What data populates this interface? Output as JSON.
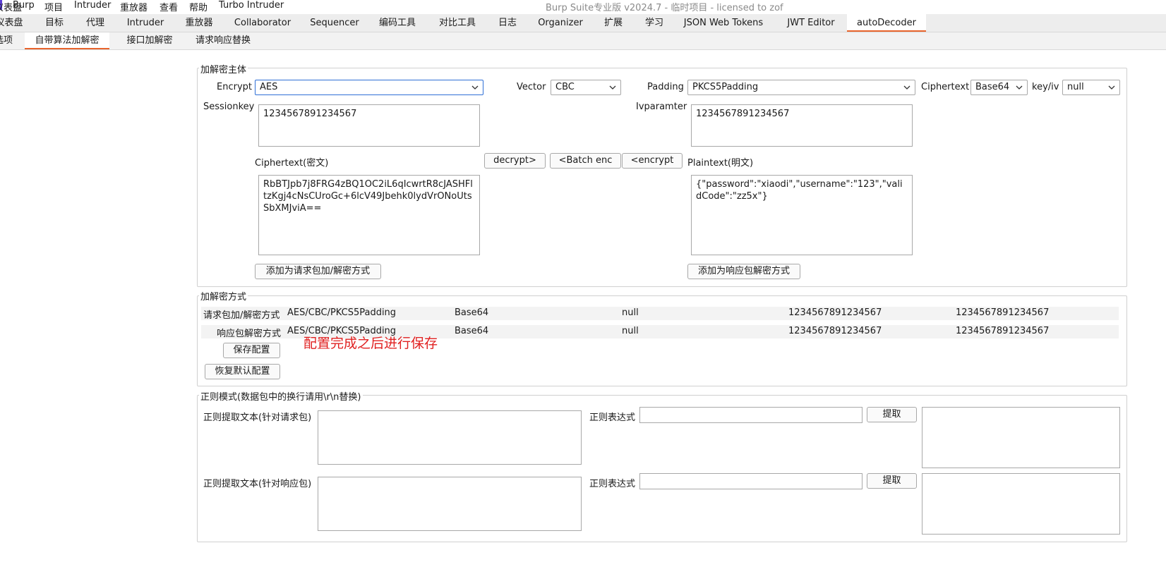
{
  "menubar": {
    "items": [
      "仪表盘",
      "Burp",
      "项目",
      "Intruder",
      "重放器",
      "查看",
      "帮助",
      "Turbo Intruder"
    ],
    "window_title": "Burp Suite专业版  v2024.7 - 临时项目 - licensed to zof"
  },
  "main_tabs": [
    "仪表盘",
    "目标",
    "代理",
    "Intruder",
    "重放器",
    "Collaborator",
    "Sequencer",
    "编码工具",
    "对比工具",
    "日志",
    "Organizer",
    "扩展",
    "学习",
    "JSON Web Tokens",
    "JWT Editor",
    "autoDecoder"
  ],
  "main_tabs_active": "autoDecoder",
  "sub_tabs": [
    "选项",
    "自带算法加解密",
    "接口加解密",
    "请求响应替换"
  ],
  "sub_tabs_active": "自带算法加解密",
  "crypto_panel": {
    "title": "加解密主体",
    "encrypt_label": "Encrypt",
    "encrypt_value": "AES",
    "vector_label": "Vector",
    "vector_value": "CBC",
    "padding_label": "Padding",
    "padding_value": "PKCS5Padding",
    "ciphertext_label": "Ciphertext",
    "ciphertext_value": "Base64",
    "keyiv_label": "key/iv",
    "keyiv_value": "null",
    "sessionkey_label": "Sessionkey",
    "sessionkey_value": "1234567891234567",
    "ivparamter_label": "Ivparamter",
    "ivparamter_value": "1234567891234567",
    "ciphertext_area_label": "Ciphertext(密文)",
    "plaintext_area_label": "Plaintext(明文)",
    "decrypt_button": "decrypt>",
    "batch_enc_button": "<Batch enc",
    "encrypt_button": "<encrypt",
    "ciphertext_text": "RbBTJpb7j8FRG4zBQ1OC2iL6qIcwrtR8cJASHFltzKgj4cNsCUroGc+6lcV49Jbehk0lydVrONoUtsSbXMJviA==",
    "plaintext_text": "{\"password\":\"xiaodi\",\"username\":\"123\",\"validCode\":\"zz5x\"}",
    "add_request_button": "添加为请求包加/解密方式",
    "add_response_button": "添加为响应包解密方式"
  },
  "methods_panel": {
    "title": "加解密方式",
    "rows": [
      {
        "label": "请求包加/解密方式",
        "algo": "AES/CBC/PKCS5Padding",
        "encoding": "Base64",
        "keyiv": "null",
        "key": "1234567891234567",
        "iv": "1234567891234567"
      },
      {
        "label": "响应包解密方式",
        "algo": "AES/CBC/PKCS5Padding",
        "encoding": "Base64",
        "keyiv": "null",
        "key": "1234567891234567",
        "iv": "1234567891234567"
      }
    ],
    "save_button": "保存配置",
    "restore_button": "恢复默认配置",
    "annotation": "配置完成之后进行保存"
  },
  "regex_panel": {
    "title": "正则模式(数据包中的换行请用\\r\\n替换)",
    "req_label": "正则提取文本(针对请求包)",
    "resp_label": "正则提取文本(针对响应包)",
    "expr_label": "正则表达式",
    "extract_button": "提取"
  },
  "colors": {
    "tab_accent": "#e8642c",
    "annotation": "#e02020",
    "focus_border": "#2f6fd6"
  }
}
